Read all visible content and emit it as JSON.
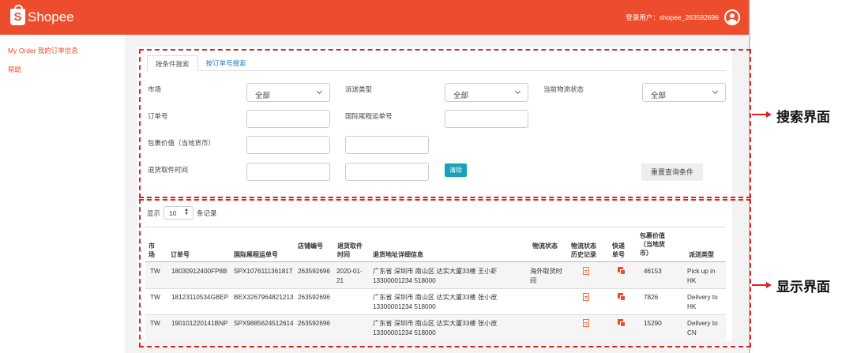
{
  "header": {
    "brand": "Shopee",
    "logo_letter": "S",
    "login_user": "登录用户：shopee_263592696",
    "brand_color": "#ee4d2d"
  },
  "sidebar": {
    "items": [
      {
        "label": "My Order 我的订单信息"
      },
      {
        "label": "帮助"
      }
    ]
  },
  "search": {
    "tabs": [
      {
        "label": "按条件搜索",
        "active": true
      },
      {
        "label": "按订单号搜索",
        "active": false
      }
    ],
    "market_label": "市场",
    "market_value": "全部",
    "delivery_type_label": "派送类型",
    "delivery_type_value": "全部",
    "logistics_status_label": "当前物流状态",
    "logistics_status_value": "全部",
    "order_no_label": "订单号",
    "intl_tracking_label": "国际尾程运单号",
    "package_value_label": "包裹价值（当地货币）",
    "return_pickup_label": "退货取件时间",
    "clear_label": "清除",
    "reset_label": "重置查询条件"
  },
  "annotations": {
    "search_area": "搜索界面",
    "display_area": "显示界面",
    "dash_color": "#e02020"
  },
  "table": {
    "show_label": "显示",
    "page_size": "10",
    "records_label": "条记录",
    "columns": [
      "市场",
      "订单号",
      "国际尾程运单号",
      "店铺编号",
      "退货取件时间",
      "退货地址详细信息",
      "物流状态",
      "物流状态历史记录",
      "快递单号",
      "包裹价值（当地货币）",
      "派送类型"
    ],
    "rows": [
      {
        "market": "TW",
        "order_no": "18030912400FP8B",
        "intl_tracking": "SPX107611136181T",
        "shop_id": "263592696",
        "pickup_date": "2020-01-",
        "pickup_date2": "21",
        "address": "广东省 深圳市 南山区 达实大厦33楼 王小虾",
        "address2": "13300001234 518000",
        "status": "海外取货时",
        "status2": "间",
        "value": "46153",
        "delivery": "Pick up in",
        "delivery2": "HK",
        "history_icon": "document-icon",
        "tracking_icon": "courier-icon"
      },
      {
        "market": "TW",
        "order_no": "18123110534GBEP",
        "intl_tracking": "BEX3267964821213",
        "shop_id": "263592696",
        "pickup_date": "",
        "pickup_date2": "",
        "address": "广东省 深圳市 南山区 达实大厦33楼 张小皮",
        "address2": "13300001234 518000",
        "status": "",
        "status2": "",
        "value": "7826",
        "delivery": "Delivery to",
        "delivery2": "HK",
        "history_icon": "document-icon",
        "tracking_icon": "courier-icon"
      },
      {
        "market": "TW",
        "order_no": "190101220141BNP",
        "intl_tracking": "SPX9885624512614",
        "shop_id": "263592696",
        "pickup_date": "",
        "pickup_date2": "",
        "address": "广东省 深圳市 南山区 达实大厦33楼 张小皮",
        "address2": "13300001234 518000",
        "status": "",
        "status2": "",
        "value": "15290",
        "delivery": "Delivery to",
        "delivery2": "CN",
        "history_icon": "document-icon",
        "tracking_icon": "courier-icon"
      }
    ]
  }
}
